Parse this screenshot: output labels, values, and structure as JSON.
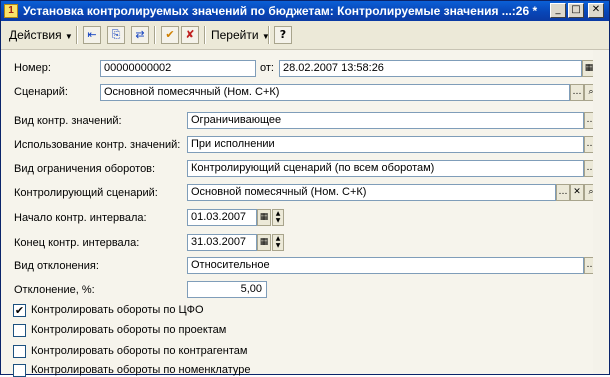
{
  "window": {
    "title": "Установка контролируемых значений по бюджетам: Контролируемые значения ...:26 *",
    "controls": {
      "minimize": "_",
      "maximize": "□",
      "close": "✕"
    }
  },
  "toolbar": {
    "actions_label": "Действия",
    "goto_label": "Перейти",
    "help_label": "?",
    "icons": [
      "arrow-left-icon",
      "copy-icon",
      "refresh-icon",
      "post-document-icon",
      "unpost-document-icon"
    ]
  },
  "form": {
    "number_label": "Номер:",
    "number_value": "00000000002",
    "date_label": "от:",
    "date_value": "28.02.2007 13:58:26",
    "scenario_label": "Сценарий:",
    "scenario_value": "Основной помесячный (Ном. С+К)",
    "control_type_label": "Вид контр. значений:",
    "control_type_value": "Ограничивающее",
    "usage_label": "Использование контр. значений:",
    "usage_value": "При исполнении",
    "turnover_limit_label": "Вид ограничения оборотов:",
    "turnover_limit_value": "Контролирующий сценарий (по всем оборотам)",
    "control_scenario_label": "Контролирующий сценарий:",
    "control_scenario_value": "Основной помесячный (Ном. С+К)",
    "interval_start_label": "Начало контр. интервала:",
    "interval_start_value": "01.03.2007",
    "interval_end_label": "Конец контр. интервала:",
    "interval_end_value": "31.03.2007",
    "deviation_type_label": "Вид отклонения:",
    "deviation_type_value": "Относительное",
    "deviation_label": "Отклонение, %:",
    "deviation_value": "5,00",
    "checkboxes": [
      {
        "label": "Контролировать обороты по ЦФО",
        "checked": true
      },
      {
        "label": "Контролировать обороты по проектам",
        "checked": false
      },
      {
        "label": "Контролировать обороты по контрагентам",
        "checked": false
      },
      {
        "label": "Контролировать обороты по номенклатуре",
        "checked": false
      }
    ]
  }
}
